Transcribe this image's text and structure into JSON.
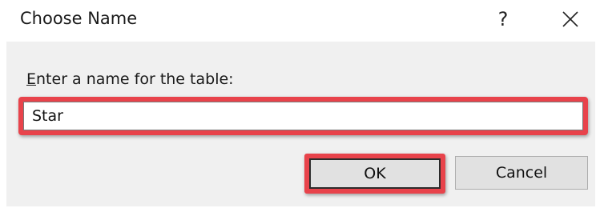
{
  "dialog": {
    "title": "Choose Name",
    "help_label": "?",
    "close_icon": "close-icon"
  },
  "form": {
    "prompt_accel": "E",
    "prompt_rest": "nter a name for the table:",
    "name_value": "Star"
  },
  "buttons": {
    "ok_label": "OK",
    "cancel_label": "Cancel"
  },
  "colors": {
    "highlight": "#e8434b",
    "body_bg": "#f0f0f0",
    "button_bg": "#e1e1e1"
  }
}
